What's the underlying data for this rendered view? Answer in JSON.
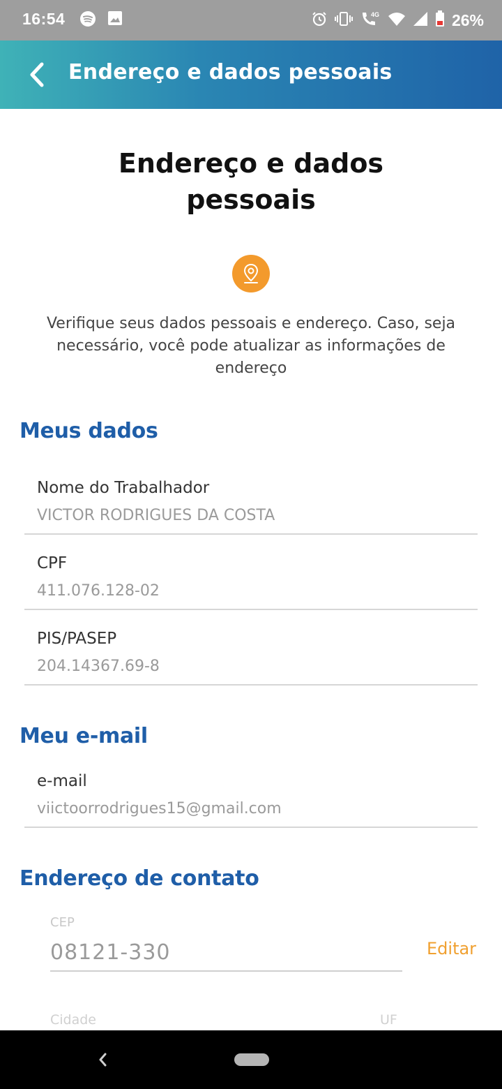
{
  "status_bar": {
    "time": "16:54",
    "battery": "26%"
  },
  "app_bar": {
    "title": "Endereço e dados pessoais"
  },
  "page": {
    "title_line1": "Endereço e dados",
    "title_line2": "pessoais",
    "intro_line1": "Verifique seus dados pessoais e endereço. Caso, seja",
    "intro_line2": "necessário, você pode atualizar as informações de",
    "intro_line3": "endereço"
  },
  "meus_dados": {
    "title": "Meus dados",
    "fields": [
      {
        "label": "Nome do Trabalhador",
        "value": "VICTOR RODRIGUES DA COSTA"
      },
      {
        "label": "CPF",
        "value": "411.076.128-02"
      },
      {
        "label": "PIS/PASEP",
        "value": "204.14367.69-8"
      }
    ]
  },
  "meu_email": {
    "title": "Meu e-mail",
    "label": "e-mail",
    "value": "viictoorrodrigues15@gmail.com"
  },
  "endereco": {
    "title": "Endereço de contato",
    "cep_label": "CEP",
    "cep_value": "08121-330",
    "edit_label": "Editar",
    "cidade_label": "Cidade",
    "uf_label": "UF"
  },
  "colors": {
    "accent_blue": "#1f5ea8",
    "accent_orange": "#f39a2c",
    "app_bar_start": "#3fb2b7",
    "app_bar_end": "#1f63a8"
  }
}
